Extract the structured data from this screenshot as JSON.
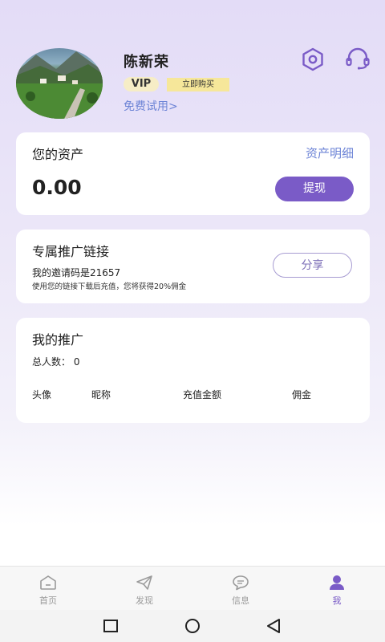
{
  "profile": {
    "name": "陈新荣",
    "vip_label": "VIP",
    "buy_label": "立即购买",
    "trial_link": "免费试用>"
  },
  "assets": {
    "title": "您的资产",
    "detail_link": "资产明细",
    "balance": "0.00",
    "withdraw_label": "提现"
  },
  "promotion": {
    "title": "专属推广链接",
    "invite_code": "我的邀请码是21657",
    "note": "使用您的链接下载后充值，您将获得20%佣金",
    "share_label": "分享"
  },
  "team": {
    "title": "我的推广",
    "total": "总人数：  0",
    "columns": [
      "头像",
      "昵称",
      "充值金额",
      "佣金"
    ]
  },
  "tabs": [
    {
      "label": "首页",
      "icon": "home-icon"
    },
    {
      "label": "发现",
      "icon": "paper-plane-icon"
    },
    {
      "label": "信息",
      "icon": "chat-bubble-icon"
    },
    {
      "label": "我",
      "icon": "person-icon",
      "active": true
    }
  ],
  "colors": {
    "accent": "#7a5bc7",
    "link": "#6d84d6",
    "vip_badge": "#f6edc6",
    "buy_badge": "#f6e79a"
  }
}
